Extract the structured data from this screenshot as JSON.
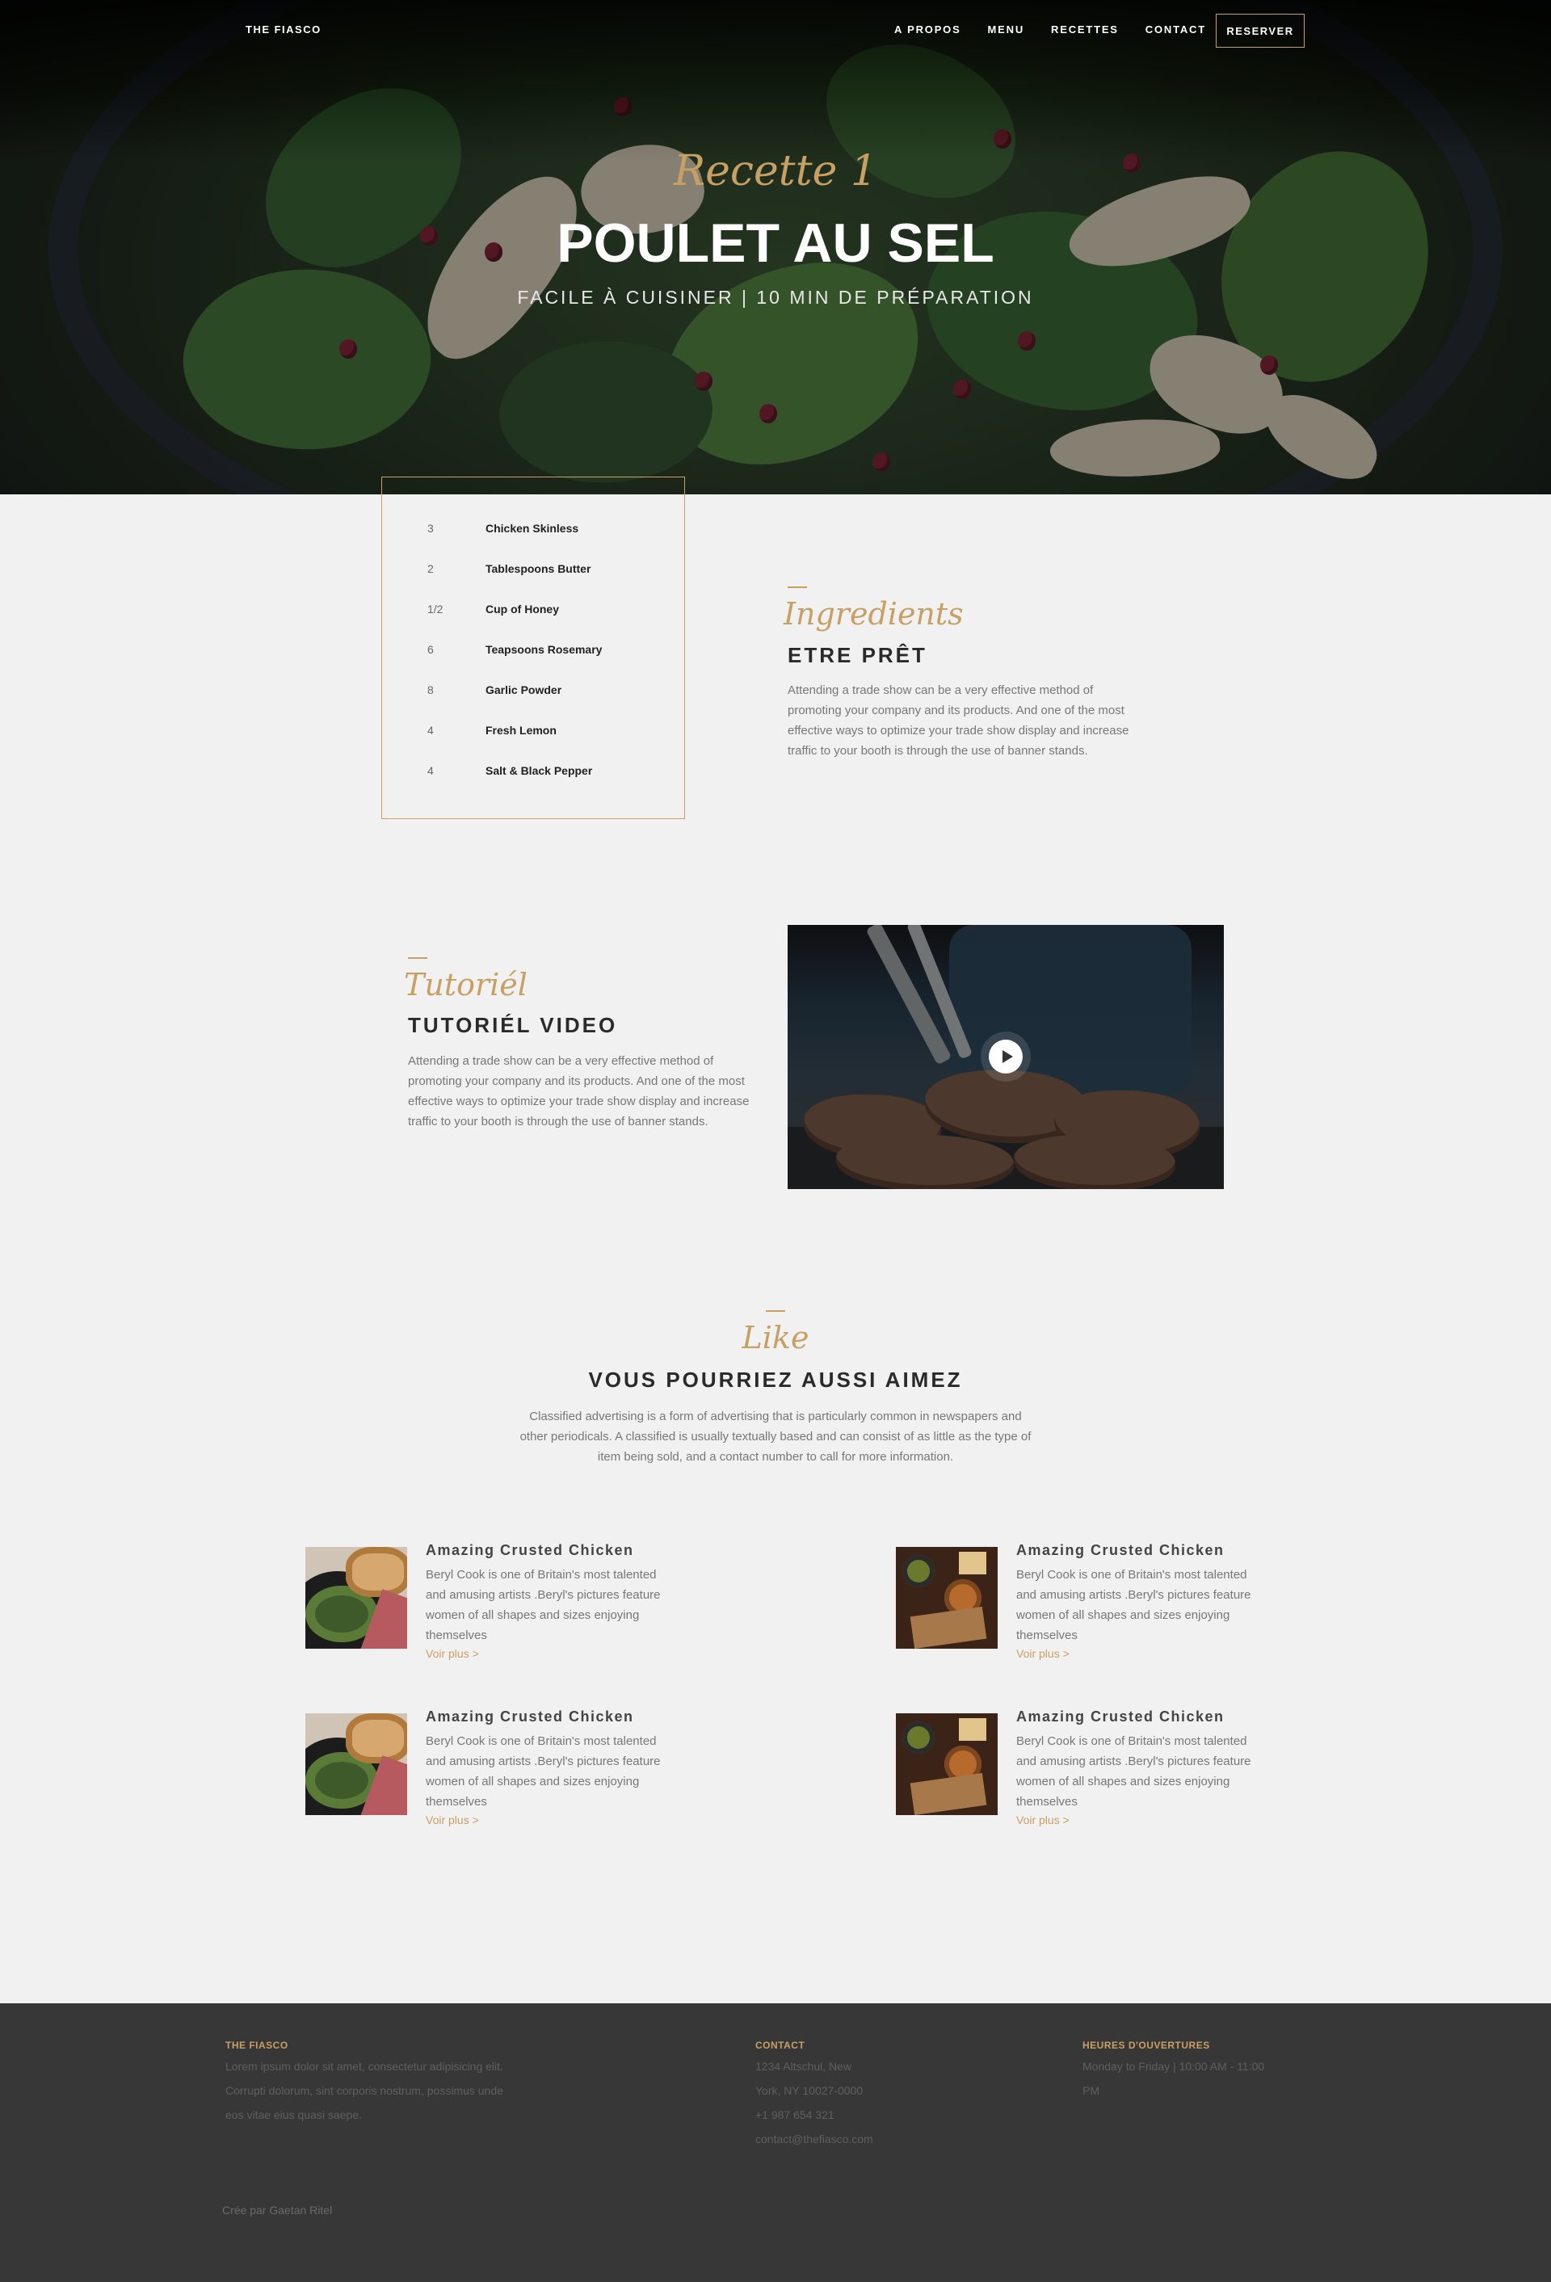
{
  "nav": {
    "brand": "THE FIASCO",
    "links": [
      "A PROPOS",
      "MENU",
      "RECETTES",
      "CONTACT"
    ],
    "reserve_label": "RESERVER"
  },
  "hero": {
    "script": "Recette 1",
    "title": "POULET AU SEL",
    "subtitle": "FACILE À CUISINER | 10 MIN DE PRÉPARATION"
  },
  "ingredients": {
    "items": [
      {
        "qty": "3",
        "name": "Chicken Skinless"
      },
      {
        "qty": "2",
        "name": "Tablespoons Butter"
      },
      {
        "qty": "1/2",
        "name": "Cup of Honey"
      },
      {
        "qty": "6",
        "name": "Teapsoons Rosemary"
      },
      {
        "qty": "8",
        "name": "Garlic Powder"
      },
      {
        "qty": "4",
        "name": "Fresh Lemon"
      },
      {
        "qty": "4",
        "name": "Salt & Black Pepper"
      }
    ],
    "script": "Ingredients",
    "title": "ETRE PRÊT",
    "paragraph": "Attending a trade show can be a very effective method of promoting your company and its products. And one of the most effective ways to optimize your trade show display and increase traffic to your booth is through the use of banner stands."
  },
  "tutorial": {
    "script": "Tutoriél",
    "title": "TUTORIÉL VIDEO",
    "paragraph": "Attending a trade show can be a very effective method of promoting your company and its products. And one of the most effective ways to optimize your trade show display and increase traffic to your booth is through the use of banner stands."
  },
  "like": {
    "script": "Like",
    "title": "VOUS POURRIEZ AUSSI AIMEZ",
    "paragraph": "Classified advertising is a form of advertising that is particularly common in newspapers and other periodicals. A classified is usually textually based and can consist of as little as the type of item being sold, and a contact number to call for more information.",
    "cards": [
      {
        "title": "Amazing Crusted Chicken",
        "text": "Beryl Cook is one of Britain's most talented and amusing artists .Beryl's pictures feature women of all shapes and sizes enjoying themselves",
        "link": "Voir plus   >"
      },
      {
        "title": "Amazing Crusted Chicken",
        "text": "Beryl Cook is one of Britain's most talented and amusing artists .Beryl's pictures feature women of all shapes and sizes enjoying themselves",
        "link": "Voir plus   >"
      },
      {
        "title": "Amazing Crusted Chicken",
        "text": "Beryl Cook is one of Britain's most talented and amusing artists .Beryl's pictures feature women of all shapes and sizes enjoying themselves",
        "link": "Voir plus   >"
      },
      {
        "title": "Amazing Crusted Chicken",
        "text": "Beryl Cook is one of Britain's most talented and amusing artists .Beryl's pictures feature women of all shapes and sizes enjoying themselves",
        "link": "Voir plus   >"
      }
    ]
  },
  "footer": {
    "about": {
      "head": "THE FIASCO",
      "lines": [
        "Lorem ipsum dolor sit amet, consectetur adipisicing elit.",
        "Corrupti dolorum, sint corporis nostrum, possimus unde",
        "eos vitae eius quasi saepe."
      ]
    },
    "contact": {
      "head": "CONTACT",
      "lines": [
        "1234 Altschul, New",
        "York, NY 10027-0000",
        "+1 987 654 321",
        "contact@thefiasco.com"
      ]
    },
    "hours": {
      "head": "HEURES D'OUVERTURES",
      "lines": [
        "Monday to Friday | 10:00 AM - 11:00",
        "PM"
      ]
    },
    "credit": "Crée par Gaetan Ritel"
  },
  "colors": {
    "accent": "#c9a063",
    "background": "#f1f1f1",
    "footer": "#373737"
  },
  "icons": {
    "video": "play-icon"
  }
}
